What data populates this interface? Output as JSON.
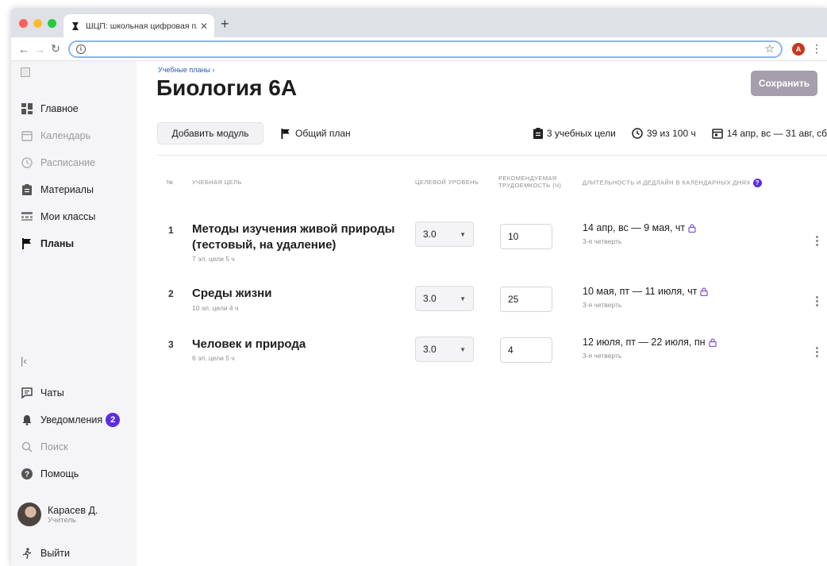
{
  "browser": {
    "tab_title": "ШЦП: школьная цифровая пла",
    "tab_close": "✕",
    "new_tab": "+",
    "profile_initial": "A"
  },
  "sidebar": {
    "items": [
      {
        "label": "Главное",
        "icon": "dashboard-icon",
        "state": "normal"
      },
      {
        "label": "Календарь",
        "icon": "calendar-icon",
        "state": "muted"
      },
      {
        "label": "Расписание",
        "icon": "clock-icon",
        "state": "muted"
      },
      {
        "label": "Материалы",
        "icon": "clipboard-icon",
        "state": "normal"
      },
      {
        "label": "Мои классы",
        "icon": "classes-icon",
        "state": "normal"
      },
      {
        "label": "Планы",
        "icon": "flag-icon",
        "state": "active"
      }
    ],
    "bottom": {
      "chats": "Чаты",
      "notifications": "Уведомления",
      "notifications_count": "2",
      "search": "Поиск",
      "help": "Помощь",
      "logout": "Выйти"
    },
    "user": {
      "name": "Карасев Д.",
      "role": "Учитель"
    }
  },
  "header": {
    "breadcrumb": "Учебные планы ›",
    "title": "Биология 6А",
    "save_label": "Сохранить",
    "add_module_label": "Добавить модуль",
    "general_plan_label": "Общий план",
    "stats": {
      "goals": "3 учебных цели",
      "hours": "39 из 100 ч",
      "dates": "14 апр, вс — 31 авг, сб"
    }
  },
  "table": {
    "headers": {
      "num": "№",
      "goal": "Учебная цель",
      "level": "Целевой уровень",
      "effort_line1": "Рекомендуемая",
      "effort_line2": "трудоемкость (ч)",
      "duration": "Длительность и дедлайн в календарных днях"
    },
    "rows": [
      {
        "num": "1",
        "title": "Методы изучения живой природы (тестовый, на удаление)",
        "meta": "7 эл. цели   5 ч",
        "level": "3.0",
        "hours": "10",
        "dates": "14 апр, вс — 9 мая, чт",
        "quarter": "3-я четверть"
      },
      {
        "num": "2",
        "title": "Среды жизни",
        "meta": "10 эл. цели   4 ч",
        "level": "3.0",
        "hours": "25",
        "dates": "10 мая, пт — 11 июля, чт",
        "quarter": "3-я четверть"
      },
      {
        "num": "3",
        "title": "Человек и природа",
        "meta": "6 эл. цели   5 ч",
        "level": "3.0",
        "hours": "4",
        "dates": "12 июля, пт — 22 июля, пн",
        "quarter": "3-я четверть"
      }
    ]
  },
  "colors": {
    "accent": "#5a2de0",
    "save_disabled": "#a59fad",
    "link": "#2a5db0"
  }
}
